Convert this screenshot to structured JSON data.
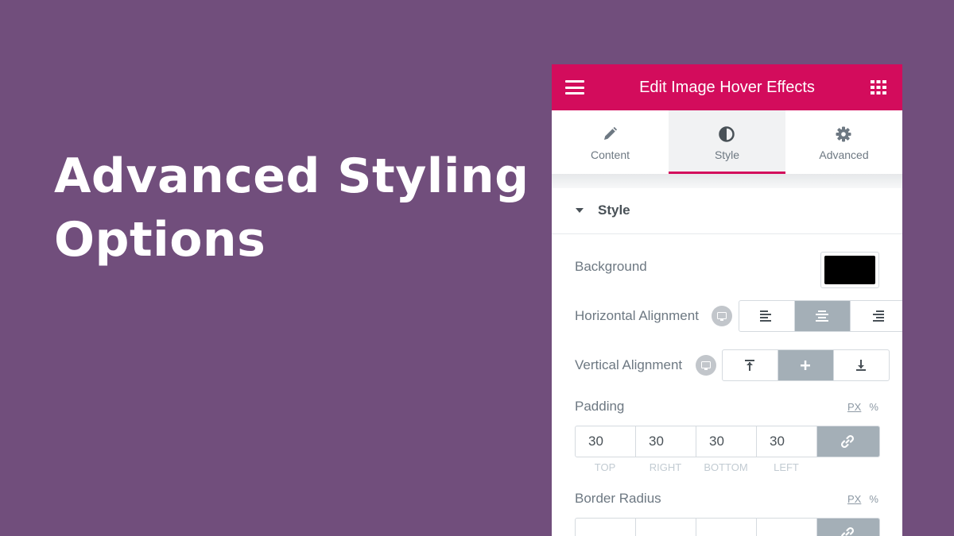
{
  "headline": {
    "line1": "Advanced Styling",
    "line2": "Options"
  },
  "panel": {
    "title": "Edit Image Hover Effects",
    "icons": {
      "menu": "hamburger-menu-icon",
      "apps": "apps-grid-icon"
    },
    "tabs": [
      {
        "label": "Content",
        "icon": "pencil-icon",
        "active": false
      },
      {
        "label": "Style",
        "icon": "half-circle-icon",
        "active": true
      },
      {
        "label": "Advanced",
        "icon": "gear-icon",
        "active": false
      }
    ],
    "section": {
      "title": "Style"
    },
    "background": {
      "label": "Background",
      "color": "#000000"
    },
    "horizontal_alignment": {
      "label": "Horizontal Alignment",
      "options": [
        "left",
        "center",
        "right"
      ],
      "selected": "center"
    },
    "vertical_alignment": {
      "label": "Vertical Alignment",
      "options": [
        "top",
        "middle",
        "bottom"
      ],
      "selected": "middle"
    },
    "padding": {
      "label": "Padding",
      "units": [
        "PX",
        "%"
      ],
      "values": [
        "30",
        "30",
        "30",
        "30"
      ],
      "sides": [
        "TOP",
        "RIGHT",
        "BOTTOM",
        "LEFT"
      ]
    },
    "border_radius": {
      "label": "Border Radius",
      "units": [
        "PX",
        "%"
      ]
    }
  },
  "colors": {
    "background": "#714e7c",
    "accent": "#d30c5c",
    "active_segment": "#a4afb7"
  }
}
